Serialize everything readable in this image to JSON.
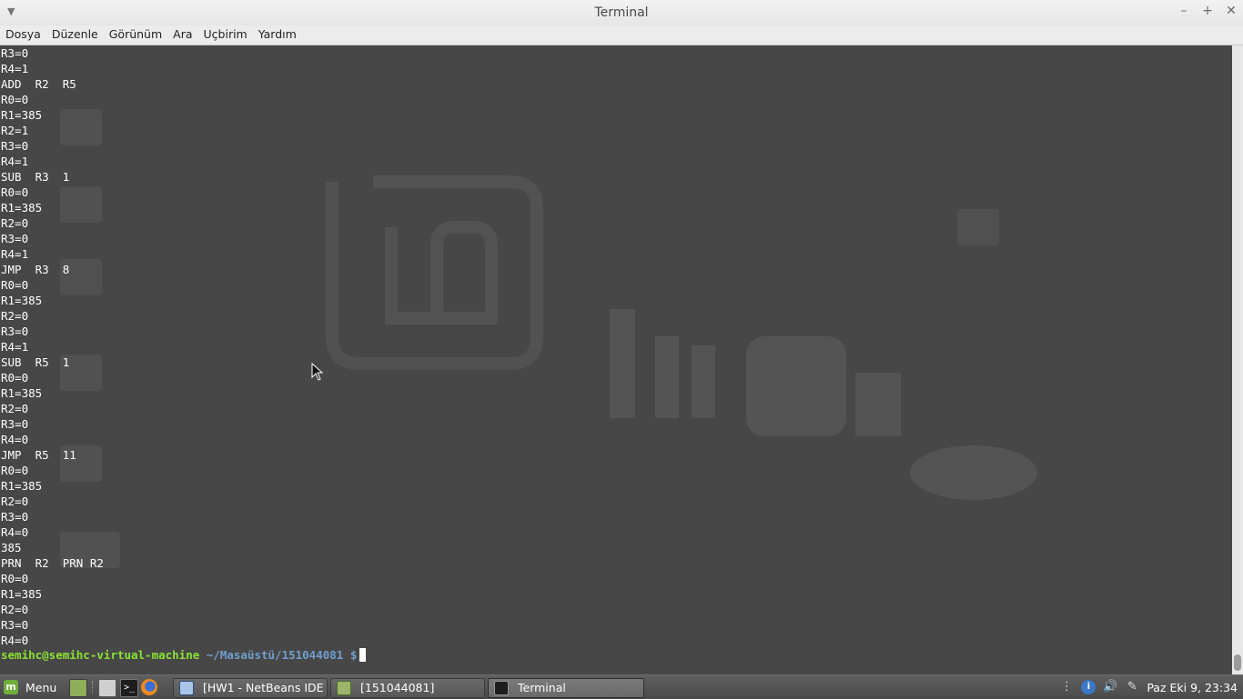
{
  "window": {
    "title": "Terminal"
  },
  "menubar": {
    "items": [
      "Dosya",
      "Düzenle",
      "Görünüm",
      "Ara",
      "Uçbirim",
      "Yardım"
    ]
  },
  "terminal": {
    "lines": [
      "R3=0",
      "R4=1",
      "ADD  R2  R5",
      "R0=0",
      "R1=385",
      "R2=1",
      "R3=0",
      "R4=1",
      "SUB  R3  1",
      "R0=0",
      "R1=385",
      "R2=0",
      "R3=0",
      "R4=1",
      "JMP  R3  8",
      "R0=0",
      "R1=385",
      "R2=0",
      "R3=0",
      "R4=1",
      "SUB  R5  1",
      "R0=0",
      "R1=385",
      "R2=0",
      "R3=0",
      "R4=0",
      "JMP  R5  11",
      "R0=0",
      "R1=385",
      "R2=0",
      "R3=0",
      "R4=0",
      "385",
      "PRN  R2  PRN R2",
      "R0=0",
      "R1=385",
      "R2=0",
      "R3=0",
      "R4=0"
    ],
    "prompt_user": "semihc@semihc-virtual-machine",
    "prompt_path": "~/Masaüstü/151044081 $"
  },
  "taskbar": {
    "menu_label": "Menu",
    "tasks": [
      {
        "label": "[HW1 - NetBeans IDE ...",
        "icon": "netbeans-icon"
      },
      {
        "label": "[151044081]",
        "icon": "folder-icon"
      },
      {
        "label": "Terminal",
        "icon": "terminal-icon"
      }
    ],
    "clock": "Paz Eki  9, 23:34"
  },
  "colors": {
    "terminal_bg": "#474747",
    "prompt_user": "#8ae234",
    "prompt_path": "#729fcf"
  }
}
